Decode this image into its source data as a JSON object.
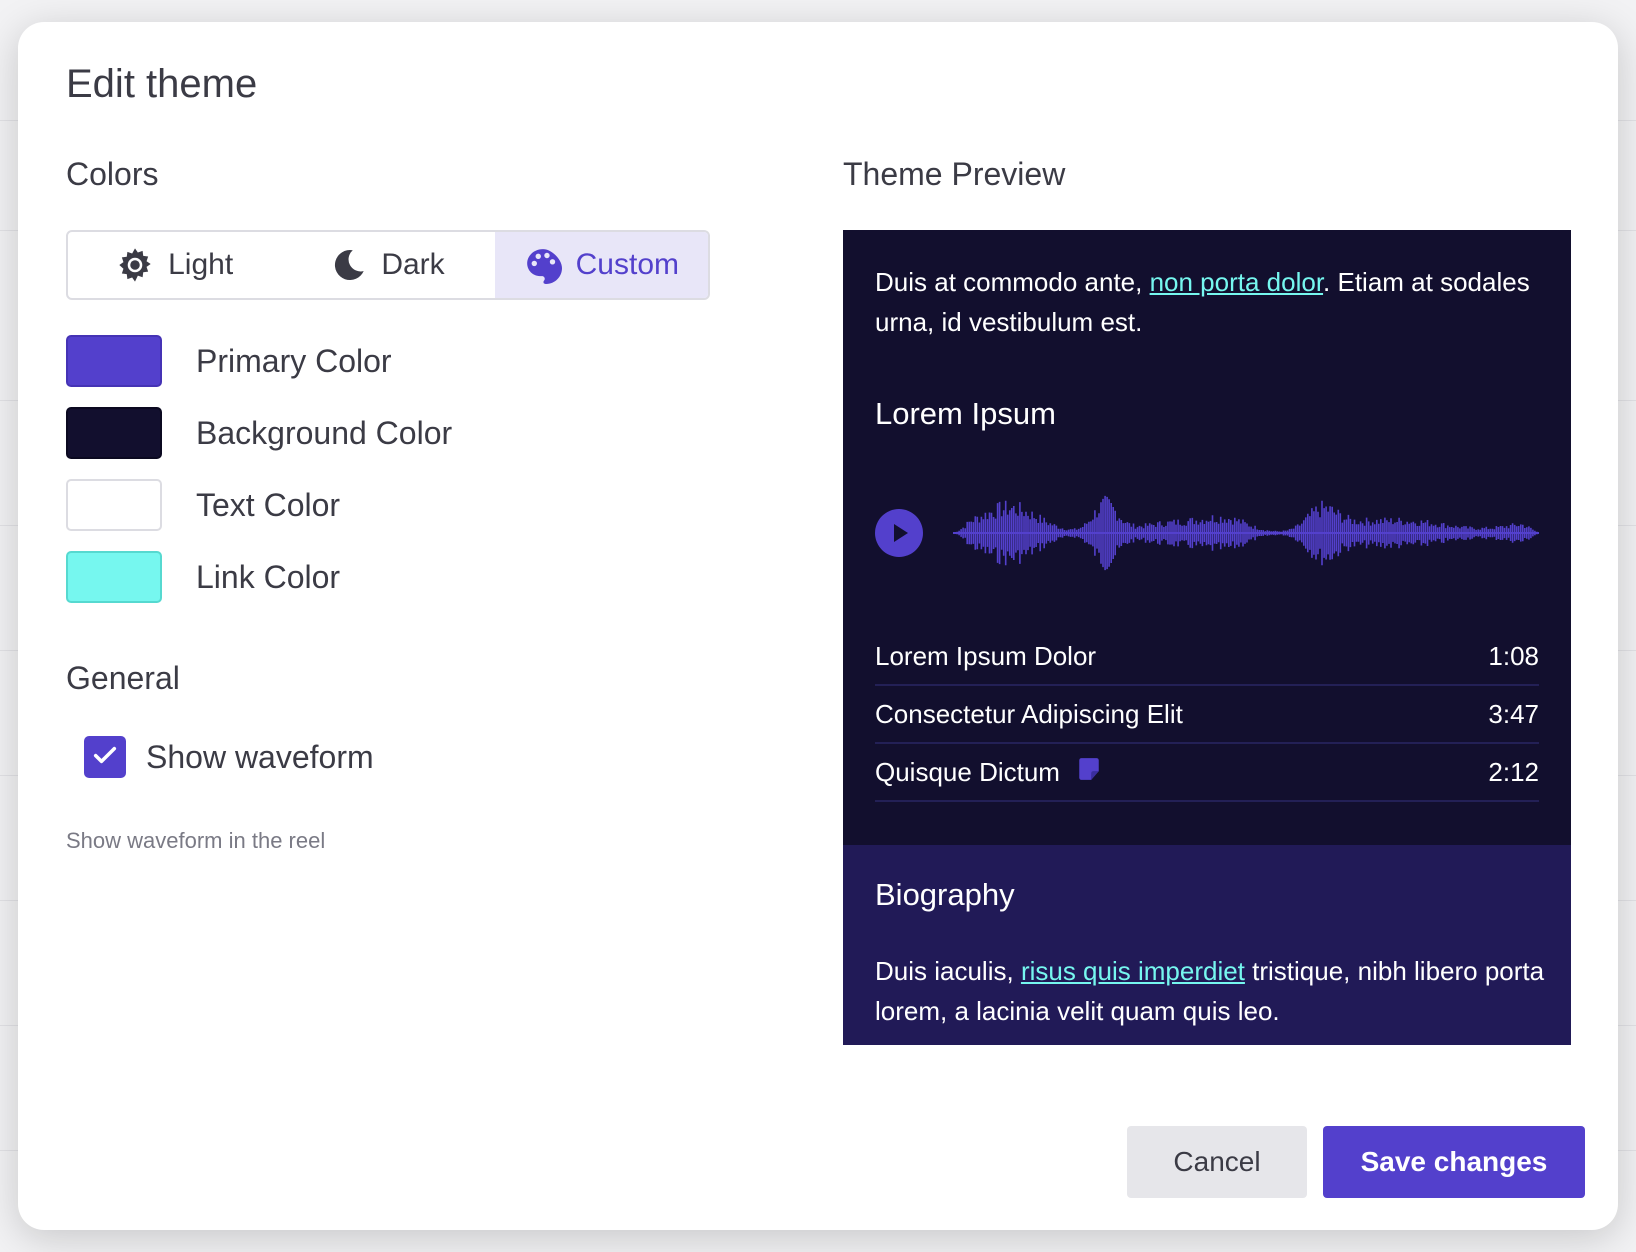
{
  "modal": {
    "title": "Edit theme"
  },
  "colors_section": {
    "heading": "Colors",
    "theme_options": [
      {
        "label": "Light",
        "icon": "sun-icon",
        "active": false
      },
      {
        "label": "Dark",
        "icon": "moon-icon",
        "active": false
      },
      {
        "label": "Custom",
        "icon": "palette-icon",
        "active": true
      }
    ],
    "swatches": [
      {
        "label": "Primary Color",
        "color": "#5340cc"
      },
      {
        "label": "Background Color",
        "color": "#120f2e"
      },
      {
        "label": "Text Color",
        "color": "#ffffff"
      },
      {
        "label": "Link Color",
        "color": "#76f7ef"
      }
    ]
  },
  "general_section": {
    "heading": "General",
    "show_waveform": {
      "label": "Show waveform",
      "checked": true,
      "helper": "Show waveform in the reel"
    }
  },
  "preview": {
    "heading": "Theme Preview",
    "intro_before": "Duis at commodo ante, ",
    "intro_link": "non porta dolor",
    "intro_after": ". Etiam at sodales urna, id vestibulum est.",
    "reel_title": "Lorem Ipsum",
    "tracks": [
      {
        "name": "Lorem Ipsum Dolor",
        "duration": "1:08",
        "has_note": false
      },
      {
        "name": "Consectetur Adipiscing Elit",
        "duration": "3:47",
        "has_note": false
      },
      {
        "name": "Quisque Dictum",
        "duration": "2:12",
        "has_note": true
      }
    ],
    "biography": {
      "heading": "Biography",
      "before": "Duis iaculis, ",
      "link": "risus quis imperdiet",
      "after": " tristique, nibh libero porta lorem, a lacinia velit quam quis leo."
    }
  },
  "footer": {
    "cancel_label": "Cancel",
    "save_label": "Save changes"
  },
  "theme_colors": {
    "primary": "#5340cc",
    "background": "#120f2e",
    "bio_background": "#211a57",
    "text": "#ffffff",
    "link": "#76f7ef"
  }
}
